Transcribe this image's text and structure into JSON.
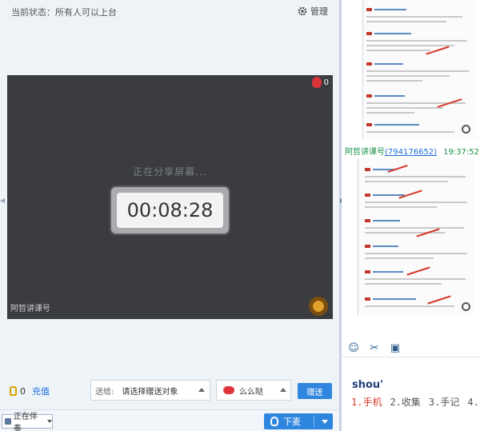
{
  "room": {
    "status_text": "当前状态：所有人可以上台",
    "manage_label": "管理",
    "fan_count": "0",
    "sharing_text": "正在分享屏幕...",
    "timer": "00:08:28",
    "host_label": "阿哲讲课号"
  },
  "gift_bar": {
    "flower_count": "0",
    "recharge_label": "充值",
    "send_label": "送给:",
    "send_value": "请选择赠送对象",
    "gift_name": "么么哒",
    "gift_button": "赠送"
  },
  "footer": {
    "mode_label": "正在伴奏",
    "mic_label": "下麦"
  },
  "chat": {
    "sender_name": "阿哲讲课号",
    "sender_qq": "(794176652)",
    "sent_time": "19:37:52"
  },
  "composer": {
    "ime_input": "shou'",
    "candidates": [
      "1.手机",
      "2.收集",
      "3.手记",
      "4."
    ]
  },
  "icons": {
    "manage": "gear-icon",
    "fans": "flower-icon",
    "flower": "lock-icon",
    "mic": "mic-icon",
    "emoji": "smiley-icon",
    "screenshot": "scissors-icon",
    "image": "image-icon",
    "zoom": "zoom-in-icon"
  },
  "colors": {
    "accent": "#2e86de",
    "stage_bg": "#3a3c40",
    "sender": "#1a8f4a",
    "link": "#1a6fd8",
    "candidate_highlight": "#d63a2a"
  }
}
